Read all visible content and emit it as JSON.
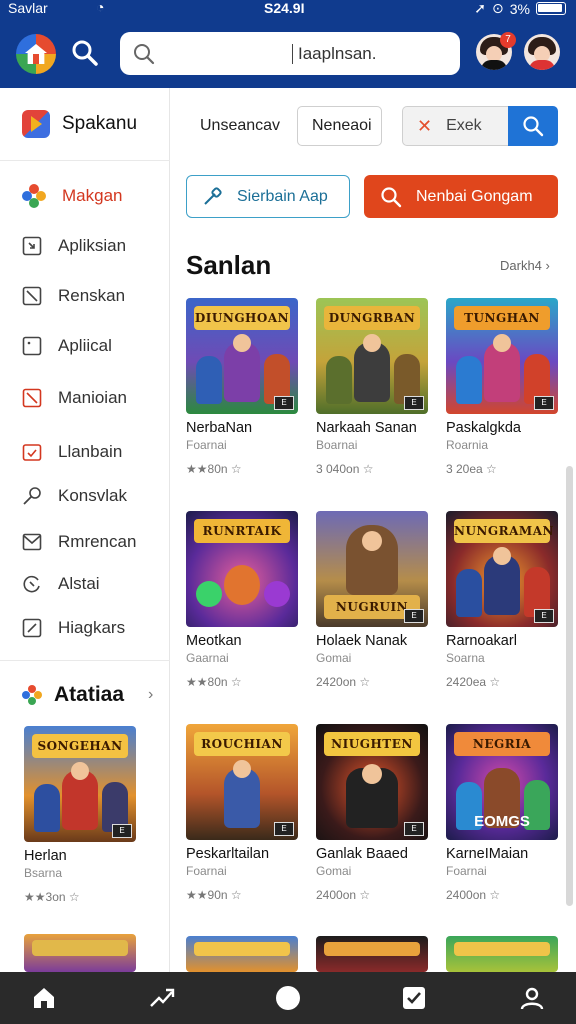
{
  "status": {
    "carrier": "Savlar",
    "clock": "S24.9I",
    "battery_pct": "3%"
  },
  "topbar": {
    "search_value": "Iaaplnsan.",
    "notification_badge": "7"
  },
  "sidebar": {
    "brand": "Spakanu",
    "items": [
      {
        "label": "Makgan",
        "icon": "flower-icon",
        "active": true
      },
      {
        "label": "Apliksian",
        "icon": "app-square-icon"
      },
      {
        "label": "Renskan",
        "icon": "slash-square-icon"
      },
      {
        "label": "Apliical",
        "icon": "dot-square-icon"
      },
      {
        "label": "Manioian",
        "icon": "red-slash-square-icon"
      },
      {
        "label": "Llanbain",
        "icon": "calendar-check-icon"
      },
      {
        "label": "Konsvlak",
        "icon": "key-icon"
      },
      {
        "label": "Rmrencan",
        "icon": "mail-icon"
      },
      {
        "label": "Alstai",
        "icon": "refresh-circle-icon"
      },
      {
        "label": "Hiagkars",
        "icon": "edit-square-icon"
      }
    ],
    "section_title": "Atatiaa",
    "section_cards": [
      {
        "title": "Herlan",
        "sub": "Bsarna",
        "meta": "★★3on ☆",
        "banner": "SONGEHAN"
      },
      {
        "title": "",
        "sub": "",
        "meta": "",
        "banner": ""
      }
    ]
  },
  "filters": {
    "field1": "Unseancav",
    "field2": "Neneaoi",
    "exek_label": "Exek"
  },
  "actions": {
    "outline_button": "Sierbain Aap",
    "solid_button": "Nenbai Gongam"
  },
  "section": {
    "title": "Sanlan",
    "see_all": "Darkh4"
  },
  "games": [
    {
      "title": "NerbaNan",
      "sub": "Foarnai",
      "meta": "★★80n ☆",
      "banner": "DIUNGHOAN"
    },
    {
      "title": "Narkaah Sanan",
      "sub": "Boarnai",
      "meta": "3 040on ☆",
      "banner": "DUNGRBAN"
    },
    {
      "title": "Paskalgkda",
      "sub": "Roarnia",
      "meta": "3 20ea ☆",
      "banner": "TUNGHAN"
    },
    {
      "title": "Meotkan",
      "sub": "Gaarnai",
      "meta": "★★80n ☆",
      "banner": "RUNRTAIK"
    },
    {
      "title": "Holaek Nanak",
      "sub": "Gomai",
      "meta": "2420on ☆",
      "banner": "NUGRUIN"
    },
    {
      "title": "Rarnoakarl",
      "sub": "Soarna",
      "meta": "2420ea ☆",
      "banner": "NUNGRAMAN"
    },
    {
      "title": "Peskarltailan",
      "sub": "Foarnai",
      "meta": "★★90n ☆",
      "banner": "ROUCHIAN"
    },
    {
      "title": "Ganlak Baaed",
      "sub": "Gomai",
      "meta": "2400on ☆",
      "banner": "NIUGHTEN"
    },
    {
      "title": "KarneIMaian",
      "sub": "Foarnai",
      "meta": "2400on ☆",
      "banner": "NEGRIA",
      "overlay": "EOMGS"
    }
  ],
  "bottom_nav": [
    "home-icon",
    "trending-icon",
    "circle-icon",
    "check-square-icon",
    "profile-icon"
  ],
  "colors": {
    "topbar": "#103b8e",
    "accent_orange": "#e0461c",
    "accent_blue": "#1f73d6"
  }
}
